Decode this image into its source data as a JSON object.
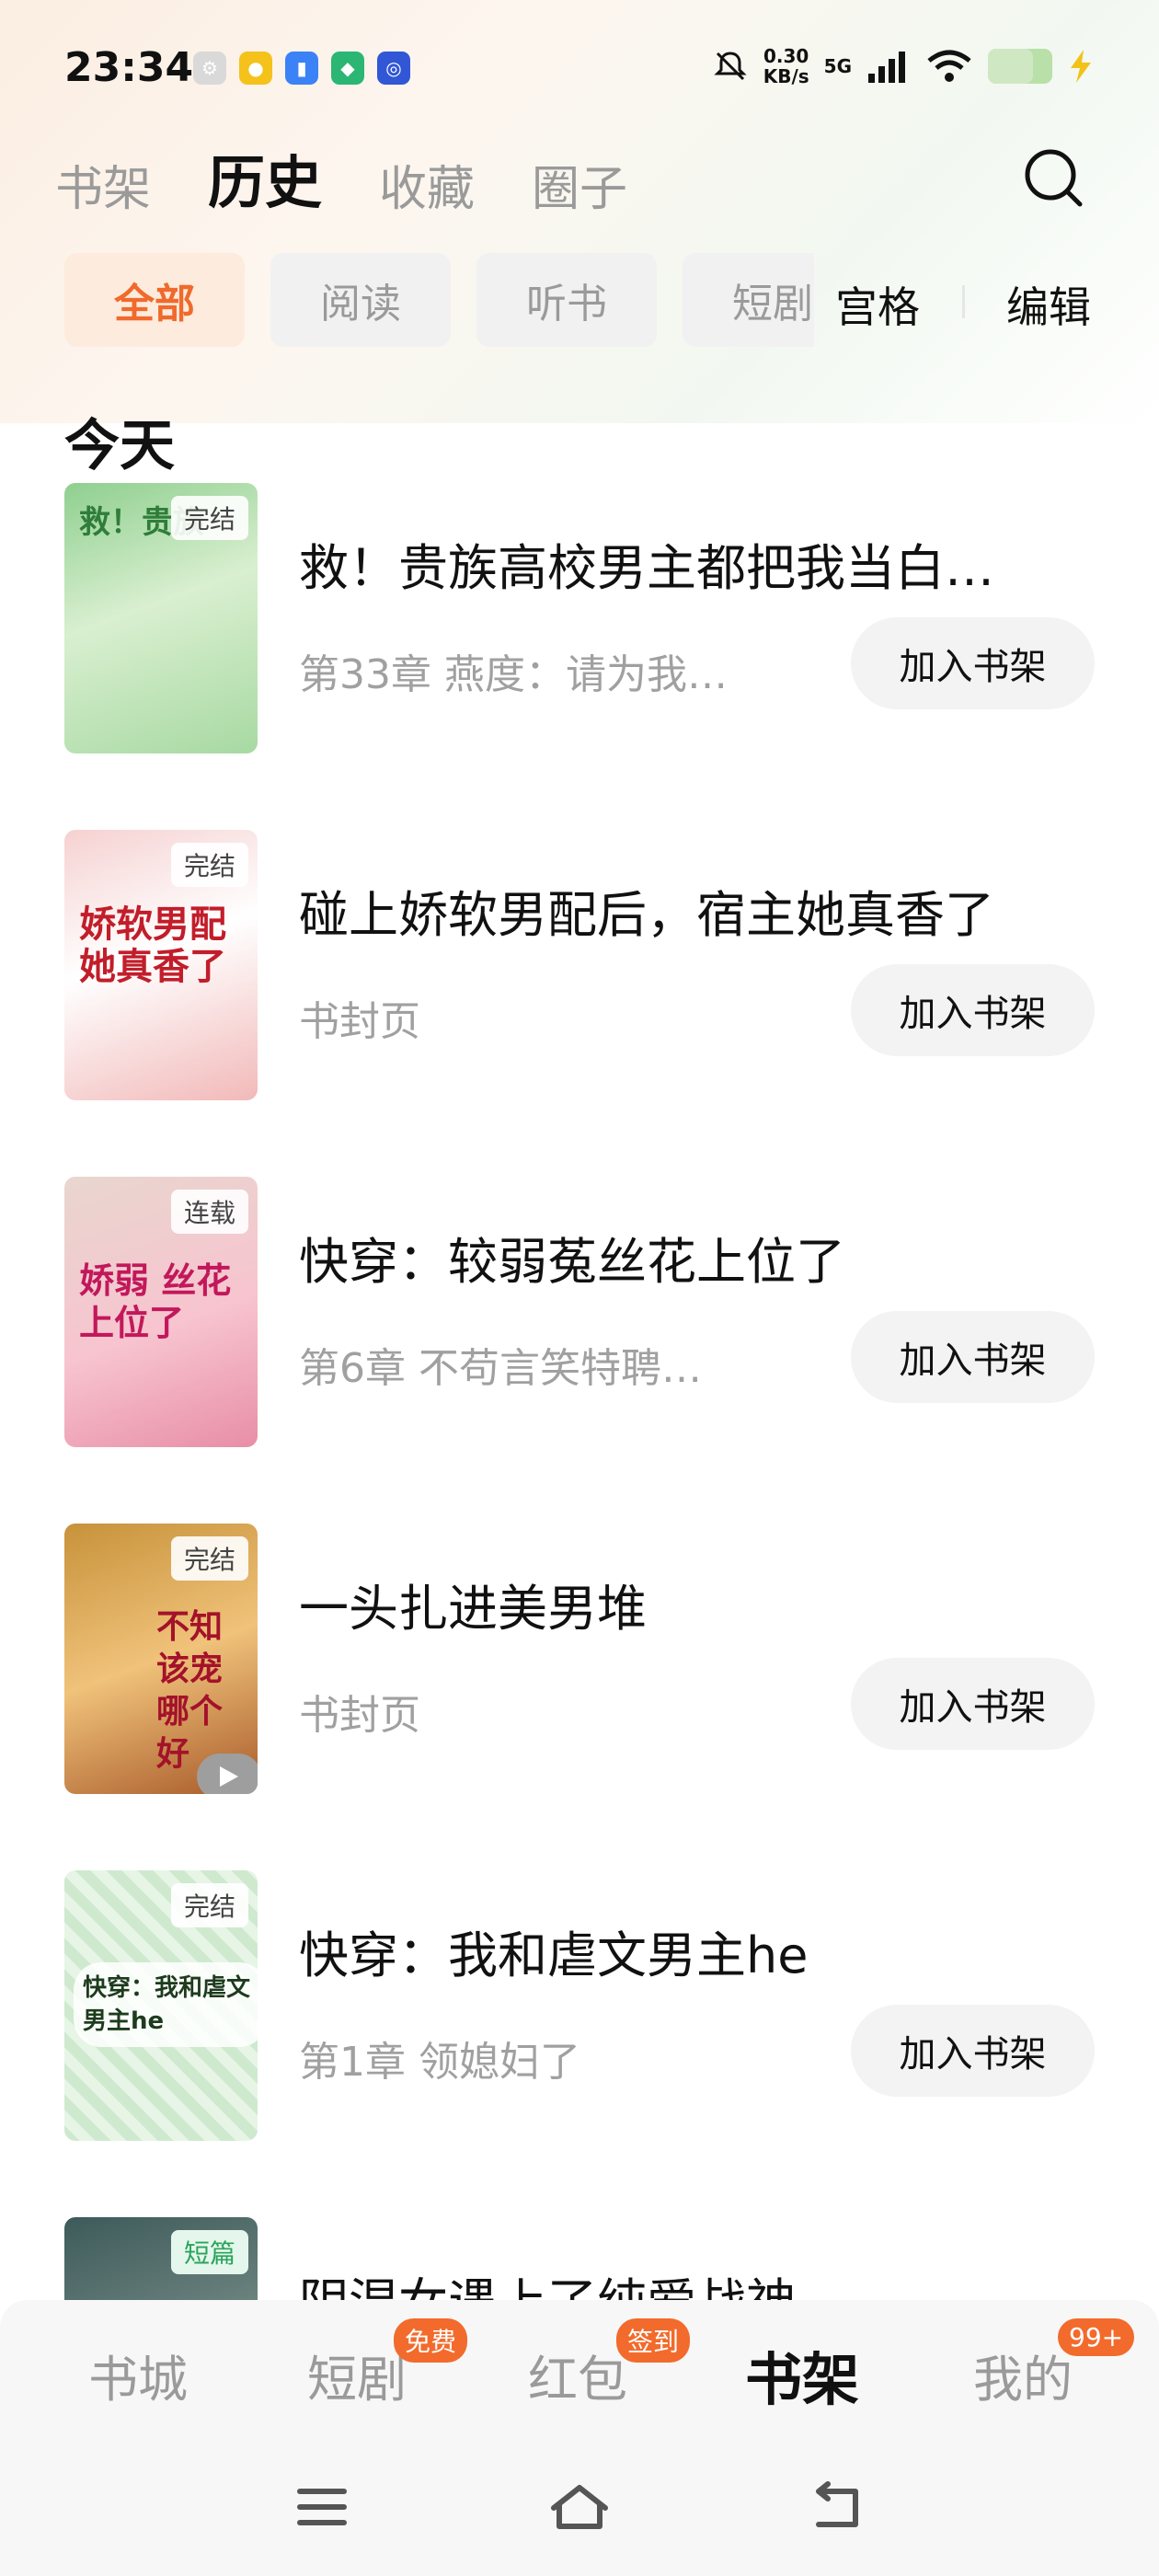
{
  "status_bar": {
    "time": "23:34",
    "net_speed_value": "0.30",
    "net_speed_unit": "KB/s",
    "network_type": "5G"
  },
  "top_tabs": [
    {
      "label": "书架",
      "active": false
    },
    {
      "label": "历史",
      "active": true
    },
    {
      "label": "收藏",
      "active": false
    },
    {
      "label": "圈子",
      "active": false
    }
  ],
  "filters": [
    {
      "label": "全部",
      "active": true
    },
    {
      "label": "阅读",
      "active": false
    },
    {
      "label": "听书",
      "active": false
    },
    {
      "label": "短剧",
      "active": false
    }
  ],
  "view_toggle_label": "宫格",
  "edit_label": "编辑",
  "section_title": "今天",
  "items": [
    {
      "title": "救！贵族高校男主都把我当白…",
      "subtitle": "第33章 燕度：请为我…",
      "badge": "完结",
      "button": "加入书架"
    },
    {
      "title": "碰上娇软男配后，宿主她真香了",
      "subtitle": "书封页",
      "badge": "完结",
      "button": "加入书架"
    },
    {
      "title": "快穿：较弱菟丝花上位了",
      "subtitle": "第6章 不苟言笑特聘…",
      "badge": "连载",
      "button": "加入书架"
    },
    {
      "title": "一头扎进美男堆",
      "subtitle": "书封页",
      "badge": "完结",
      "button": "加入书架"
    },
    {
      "title": "快穿：我和虐文男主he",
      "subtitle": "第1章 领媳妇了",
      "badge": "完结",
      "button": "加入书架"
    },
    {
      "title": "阴湿女遇上了纯爱战神",
      "subtitle": "",
      "badge": "短篇",
      "button": ""
    }
  ],
  "covers": {
    "item0_text": "救！贵族",
    "item1_text": "娇软男配 她真香了",
    "item2_text": "娇弱 丝花上位了",
    "item3_text": "不知该宠哪个好",
    "item4_text": "快穿：我和虐文男主he"
  },
  "bottom_nav": [
    {
      "label": "书城",
      "active": false,
      "badge": ""
    },
    {
      "label": "短剧",
      "active": false,
      "badge": "免费"
    },
    {
      "label": "红包",
      "active": false,
      "badge": "签到"
    },
    {
      "label": "书架",
      "active": true,
      "badge": ""
    },
    {
      "label": "我的",
      "active": false,
      "badge": "99+"
    }
  ],
  "colors": {
    "accent": "#f06a2c",
    "badge_bg": "#f26b2c"
  }
}
